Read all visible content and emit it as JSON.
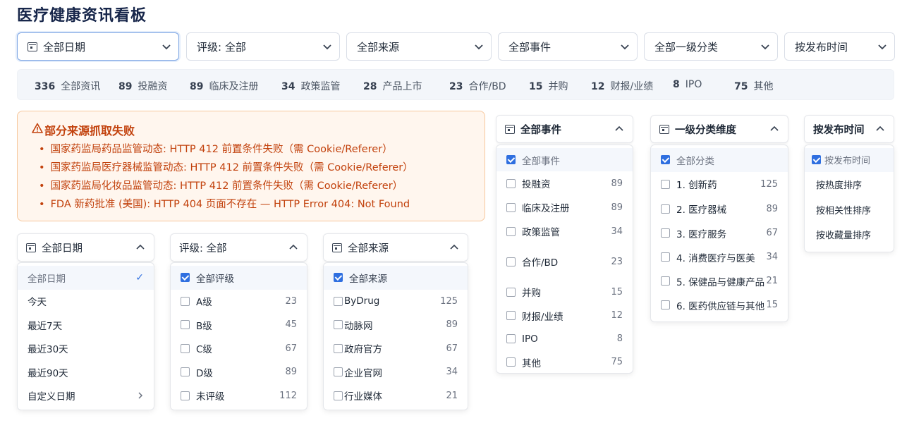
{
  "title": "医疗健康资讯看板",
  "filters": [
    {
      "label": "全部日期",
      "icon": "calendar-icon"
    },
    {
      "label": "评级: 全部"
    },
    {
      "label": "全部来源"
    },
    {
      "label": "全部事件"
    },
    {
      "label": "全部一级分类"
    },
    {
      "label": "按发布时间"
    }
  ],
  "stats": [
    {
      "count": "336",
      "label": "全部资讯"
    },
    {
      "count": "89",
      "label": "投融资"
    },
    {
      "count": "89",
      "label": "临床及注册"
    },
    {
      "count": "34",
      "label": "政策监管"
    },
    {
      "count": "28",
      "label": "产品上市"
    },
    {
      "count": "23",
      "label": "合作/BD"
    },
    {
      "count": "15",
      "label": "并购"
    },
    {
      "count": "12",
      "label": "财报/业绩"
    },
    {
      "count": "8",
      "label": "IPO"
    },
    {
      "count": "75",
      "label": "其他"
    }
  ],
  "alert": {
    "title": "部分来源抓取失败",
    "items": [
      "国家药监局药品监管动态: HTTP 412 前置条件失败（需 Cookie/Referer）",
      "国家药监局医疗器械监管动态: HTTP 412 前置条件失败（需 Cookie/Referer）",
      "国家药监局化妆品监管动态: HTTP 412 前置条件失败（需 Cookie/Referer）",
      "FDA 新药批准 (美国): HTTP 404 页面不存在 — HTTP Error 404: Not Found"
    ]
  },
  "date_dropdown": {
    "header": "全部日期",
    "options": [
      "全部日期",
      "今天",
      "最近7天",
      "最近30天",
      "最近90天",
      "自定义日期"
    ]
  },
  "rating_dropdown": {
    "header": "评级: 全部",
    "options": [
      {
        "label": "全部评级",
        "count": ""
      },
      {
        "label": "A级",
        "count": "23"
      },
      {
        "label": "B级",
        "count": "45"
      },
      {
        "label": "C级",
        "count": "67"
      },
      {
        "label": "D级",
        "count": "89"
      },
      {
        "label": "未评级",
        "count": "112"
      }
    ]
  },
  "source_dropdown": {
    "header": "全部来源",
    "options": [
      {
        "label": "全部来源",
        "count": ""
      },
      {
        "label": "ByDrug",
        "count": "125"
      },
      {
        "label": "动脉网",
        "count": "89"
      },
      {
        "label": "政府官方",
        "count": "67"
      },
      {
        "label": "企业官网",
        "count": "34"
      },
      {
        "label": "行业媒体",
        "count": "21"
      }
    ]
  },
  "event_dropdown": {
    "header": "全部事件",
    "options": [
      {
        "label": "全部事件",
        "count": ""
      },
      {
        "label": "投融资",
        "count": "89"
      },
      {
        "label": "临床及注册",
        "count": "89"
      },
      {
        "label": "政策监管",
        "count": "34"
      },
      {
        "label": "合作/BD",
        "count": "23"
      },
      {
        "label": "并购",
        "count": "15"
      },
      {
        "label": "财报/业绩",
        "count": "12"
      },
      {
        "label": "IPO",
        "count": "8"
      },
      {
        "label": "其他",
        "count": "75"
      }
    ]
  },
  "category_dropdown": {
    "header": "一级分类维度",
    "options": [
      {
        "label": "全部分类",
        "count": ""
      },
      {
        "label": "1. 创新药",
        "count": "125"
      },
      {
        "label": "2. 医疗器械",
        "count": "89"
      },
      {
        "label": "3. 医疗服务",
        "count": "67"
      },
      {
        "label": "4. 消费医疗与医美",
        "count": "34"
      },
      {
        "label": "5. 保健品与健康产品",
        "count": "21"
      },
      {
        "label": "6. 医药供应链与其他",
        "count": "15"
      }
    ]
  },
  "sort_dropdown": {
    "header": "按发布时间",
    "options": [
      "按发布时间",
      "按热度排序",
      "按相关性排序",
      "按收藏量排序"
    ]
  },
  "colors": {
    "accent": "#2f6fe0",
    "warning": "#c2410c",
    "title": "#17264a"
  }
}
